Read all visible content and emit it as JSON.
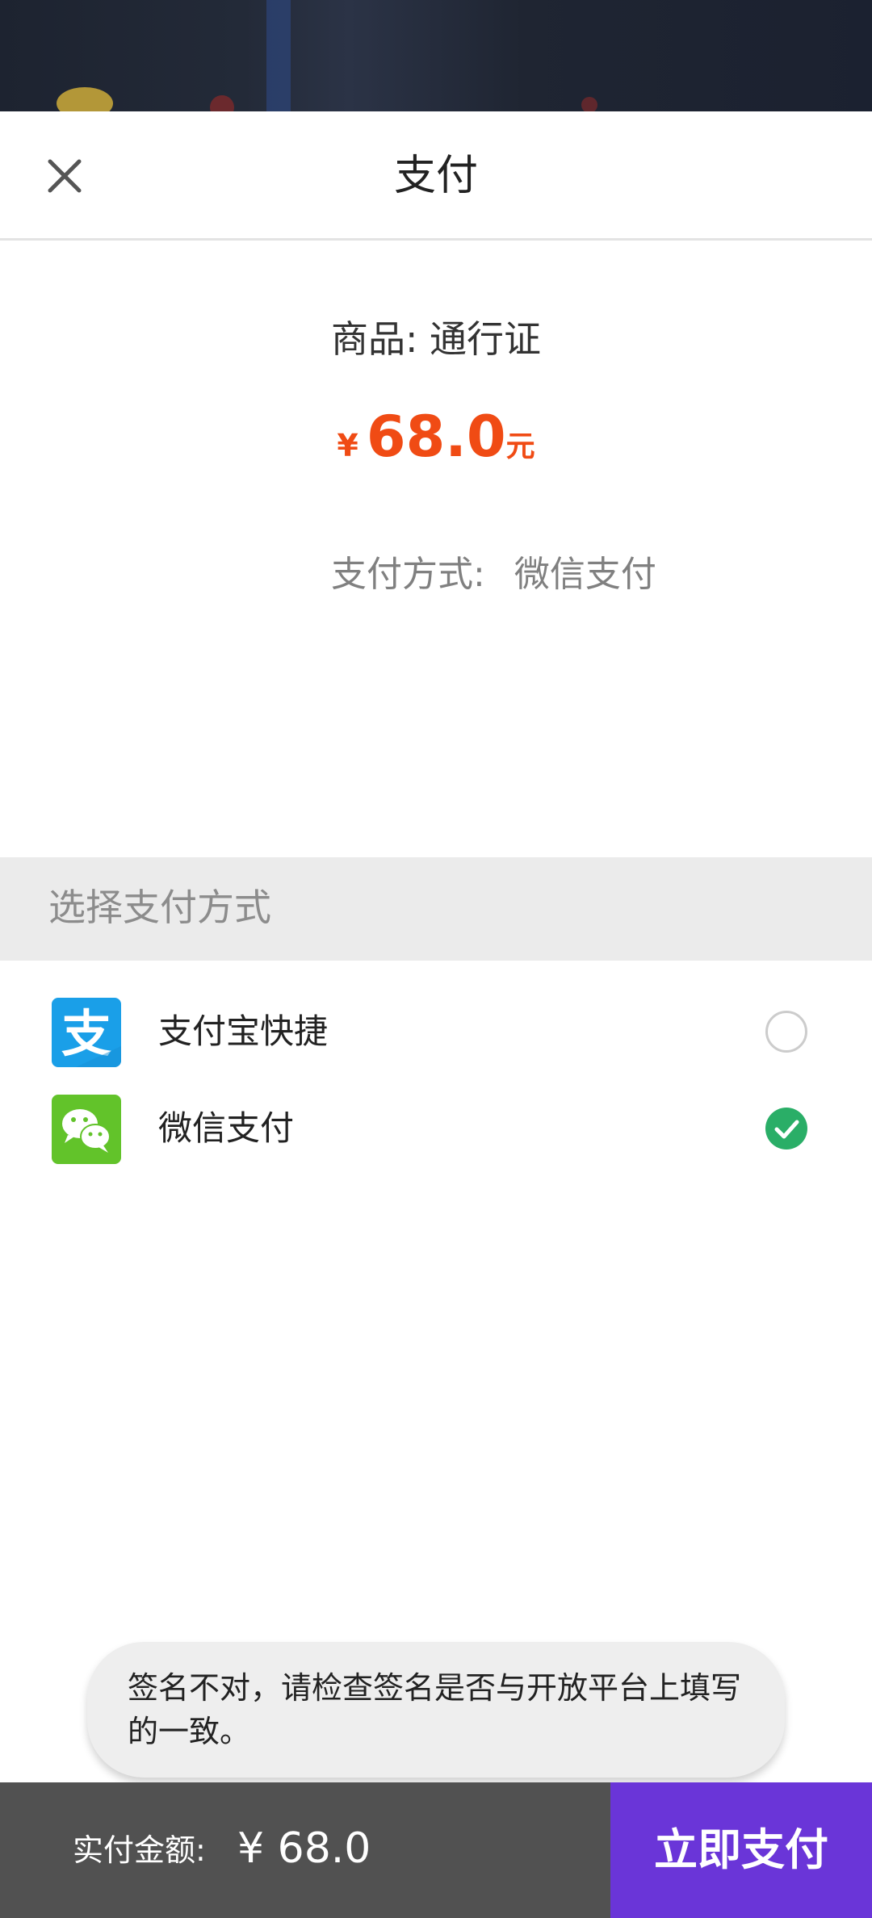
{
  "colors": {
    "accent_price": "#f04b14",
    "pay_button": "#6a35d8",
    "bottom_bar": "#515151",
    "wechat_green": "#2aae67",
    "alipay_blue": "#1a9fe8",
    "wechat_icon_green": "#62c32a"
  },
  "header": {
    "title": "支付",
    "close_icon": "close-icon"
  },
  "order": {
    "product_text": "商品: 通行证",
    "currency_symbol": "¥",
    "amount": "68.0",
    "unit": "元",
    "method_label": "支付方式:",
    "method_value": "微信支付"
  },
  "select_section": {
    "title": "选择支付方式"
  },
  "payment_methods": [
    {
      "label": "支付宝快捷",
      "icon": "alipay-icon",
      "selected": false
    },
    {
      "label": "微信支付",
      "icon": "wechat-icon",
      "selected": true
    }
  ],
  "toast": {
    "message": "签名不对，请检查签名是否与开放平台上填写的一致。"
  },
  "bottom_bar": {
    "total_label": "实付金额:",
    "total_value": "¥ 68.0",
    "pay_button_label": "立即支付"
  }
}
